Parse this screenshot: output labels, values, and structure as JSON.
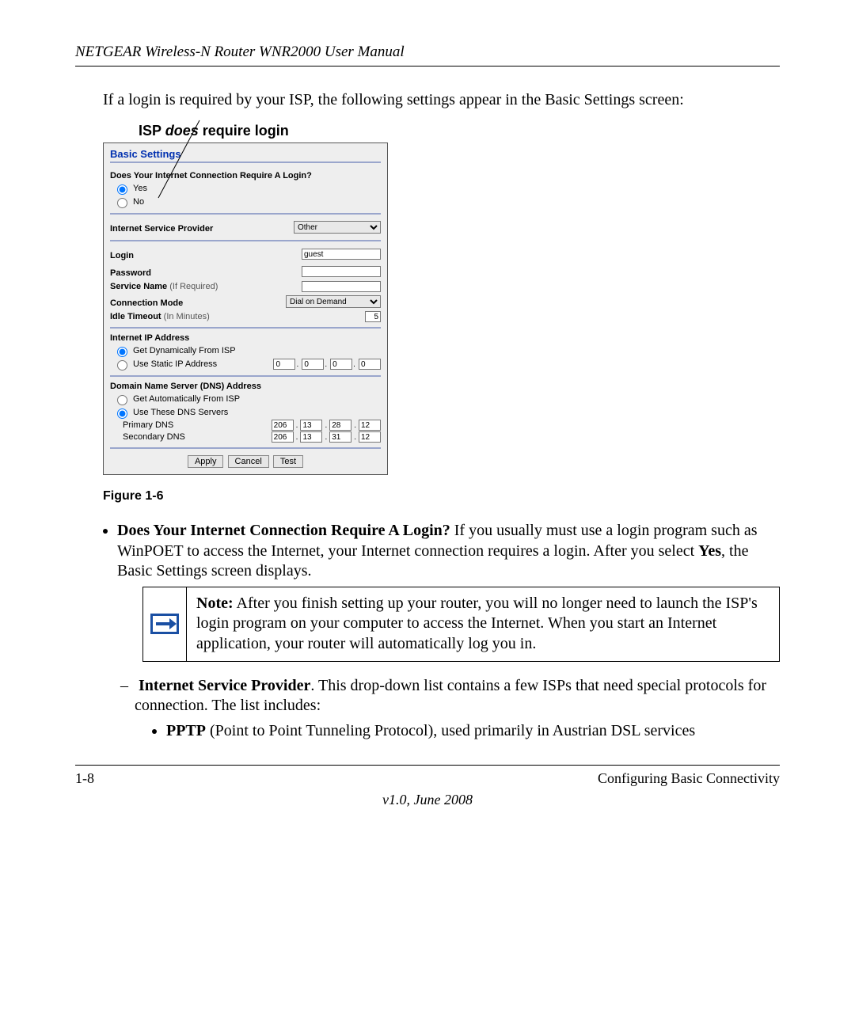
{
  "header": "NETGEAR Wireless-N Router WNR2000 User Manual",
  "intro": "If a login is required by your ISP, the following settings appear in the Basic Settings screen:",
  "callout_prefix": "ISP ",
  "callout_em": "does",
  "callout_suffix": " require login",
  "shot": {
    "title": "Basic Settings",
    "require_q": "Does Your Internet Connection Require A Login?",
    "yes": "Yes",
    "no": "No",
    "isp_label": "Internet Service Provider",
    "isp_value": "Other",
    "login_label": "Login",
    "login_value": "guest",
    "password_label": "Password",
    "service_label": "Service Name",
    "service_paren": "(If Required)",
    "conn_mode_label": "Connection Mode",
    "conn_mode_value": "Dial on Demand",
    "idle_label": "Idle Timeout",
    "idle_paren": "(In Minutes)",
    "idle_value": "5",
    "ip_title": "Internet IP Address",
    "ip_dyn": "Get Dynamically From ISP",
    "ip_static": "Use Static IP Address",
    "ip_octets": [
      "0",
      "0",
      "0",
      "0"
    ],
    "dns_title": "Domain Name Server (DNS) Address",
    "dns_auto": "Get Automatically From ISP",
    "dns_use": "Use These DNS Servers",
    "dns_primary": "Primary DNS",
    "dns_primary_oct": [
      "206",
      "13",
      "28",
      "12"
    ],
    "dns_secondary": "Secondary DNS",
    "dns_secondary_oct": [
      "206",
      "13",
      "31",
      "12"
    ],
    "btn_apply": "Apply",
    "btn_cancel": "Cancel",
    "btn_test": "Test"
  },
  "figure_caption": "Figure 1-6",
  "bullet1_bold": "Does Your Internet Connection Require A Login?",
  "bullet1_rest": " If you usually must use a login program such as WinPOET to access the Internet, your Internet connection requires a login. After you select ",
  "bullet1_yes": "Yes",
  "bullet1_tail": ", the Basic Settings screen displays.",
  "note_bold": "Note:",
  "note_text": " After you finish setting up your router, you will no longer need to launch the ISP's login program on your computer to access the Internet. When you start an Internet application, your router will automatically log you in.",
  "sub1_bold": "Internet Service Provider",
  "sub1_rest": ". This drop-down list contains a few ISPs that need special protocols for connection. The list includes:",
  "sub2_bold": "PPTP",
  "sub2_rest": " (Point to Point Tunneling Protocol), used primarily in Austrian DSL services",
  "footer_left": "1-8",
  "footer_right": "Configuring Basic Connectivity",
  "version": "v1.0, June 2008"
}
